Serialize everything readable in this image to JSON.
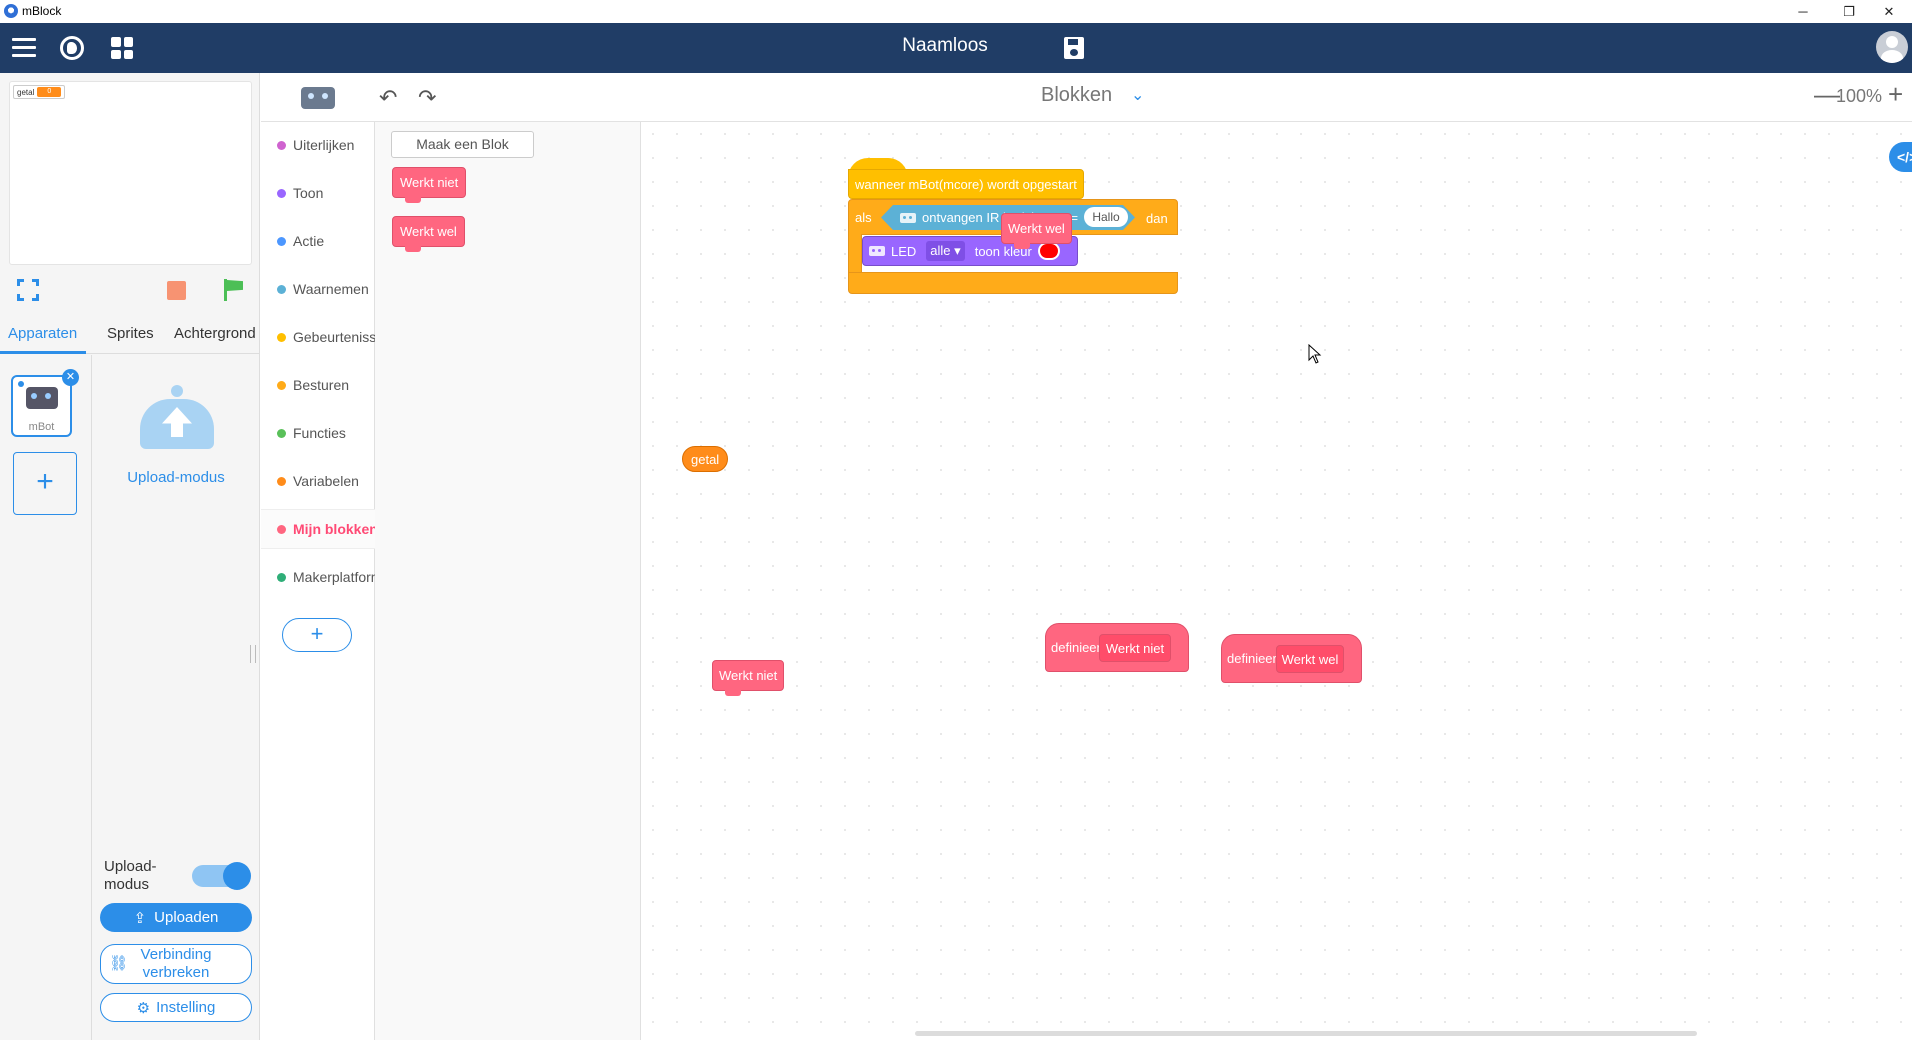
{
  "window": {
    "app_title": "mBlock",
    "minimize_glyph": "─",
    "maximize_glyph": "❐",
    "close_glyph": "✕"
  },
  "header": {
    "doc_title": "Naamloos",
    "icons": [
      "menu-icon",
      "globe-icon",
      "grid-icon",
      "save-icon",
      "user-avatar-icon"
    ]
  },
  "stage": {
    "mini_label": "getal",
    "mini_value": "0"
  },
  "left_tabs": [
    "Apparaten",
    "Sprites",
    "Achtergrond"
  ],
  "device": {
    "name": "mBot",
    "close_glyph": "✕",
    "add_glyph": "+"
  },
  "upload": {
    "illustration_label": "Upload-modus",
    "mode_label_1": "Upload-",
    "mode_label_2": "modus",
    "mode_on": true,
    "upload_btn": "Uploaden",
    "disconnect_btn_1": "Verbinding",
    "disconnect_btn_2": "verbreken",
    "settings_btn": "Instelling"
  },
  "toolbar": {
    "undo_glyph": "↶",
    "redo_glyph": "↷",
    "mode": "Blokken",
    "caret": "⌄",
    "zoom_out": "—",
    "zoom": "100%",
    "zoom_in": "+"
  },
  "categories": [
    {
      "label": "Uiterlijken",
      "color": "#cf63cf"
    },
    {
      "label": "Toon",
      "color": "#9966ff"
    },
    {
      "label": "Actie",
      "color": "#4c97ff"
    },
    {
      "label": "Waarnemen",
      "color": "#5cb1d6"
    },
    {
      "label": "Gebeurtenissen",
      "color": "#ffbf00"
    },
    {
      "label": "Besturen",
      "color": "#ffab19"
    },
    {
      "label": "Functies",
      "color": "#59c059"
    },
    {
      "label": "Variabelen",
      "color": "#ff8c1a"
    },
    {
      "label": "Mijn blokken",
      "color": "#ff6680",
      "active": true
    },
    {
      "label": "Makerplatform",
      "color": "#2fae78"
    }
  ],
  "cat_add_glyph": "+",
  "palette": {
    "make_block": "Maak een Blok",
    "blocks": [
      "Werkt niet",
      "Werkt wel"
    ]
  },
  "canvas": {
    "code_toggle": "</>",
    "hat_label": "wanneer mBot(mcore) wordt opgestart",
    "if_label": "als",
    "ir_label": "ontvangen IR bericht",
    "equals": "=",
    "compare_value": "Hallo",
    "then_label": "dan",
    "led_label": "LED",
    "led_target": "alle",
    "led_caret": "▾",
    "led_action": "toon kleur",
    "led_color": "#ff0000",
    "loose_call_1": "Werkt wel",
    "loose_call_2": "Werkt niet",
    "variable_reporter": "getal",
    "define_label": "definieer",
    "define_1_name": "Werkt niet",
    "define_2_name": "Werkt wel"
  }
}
